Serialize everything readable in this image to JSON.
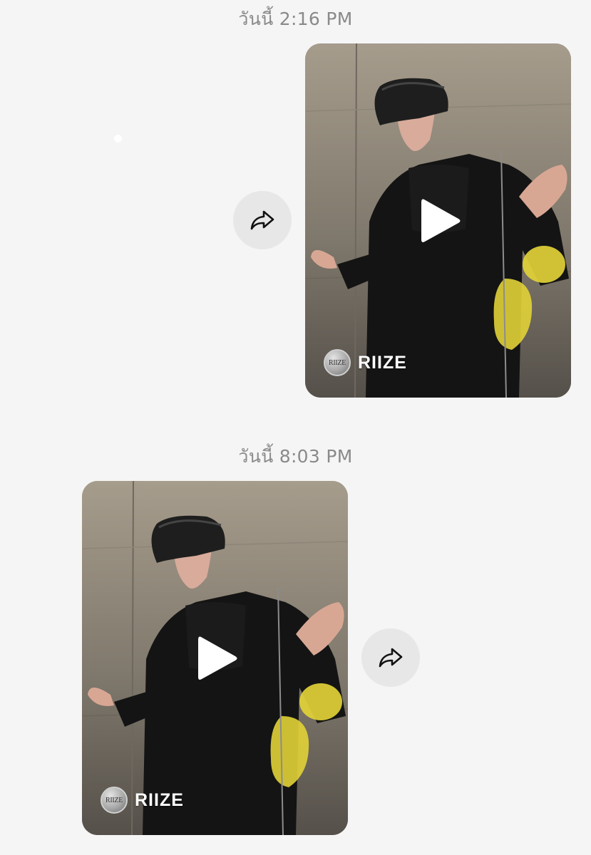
{
  "messages": [
    {
      "timestamp": "วันนี้ 2:16 PM",
      "side": "right",
      "video": {
        "channel_name": "RIIZE",
        "channel_logo_text": "RIIZE",
        "play_icon": "play-icon"
      },
      "share_icon": "share-arrow-icon"
    },
    {
      "timestamp": "วันนี้ 8:03 PM",
      "side": "left",
      "video": {
        "channel_name": "RIIZE",
        "channel_logo_text": "RIIZE",
        "play_icon": "play-icon"
      },
      "share_icon": "share-arrow-icon"
    }
  ],
  "colors": {
    "background": "#f5f5f5",
    "timestamp_text": "#8a8a8a",
    "share_button_bg": "#e7e7e7",
    "yellow_print": "#e1d137"
  }
}
